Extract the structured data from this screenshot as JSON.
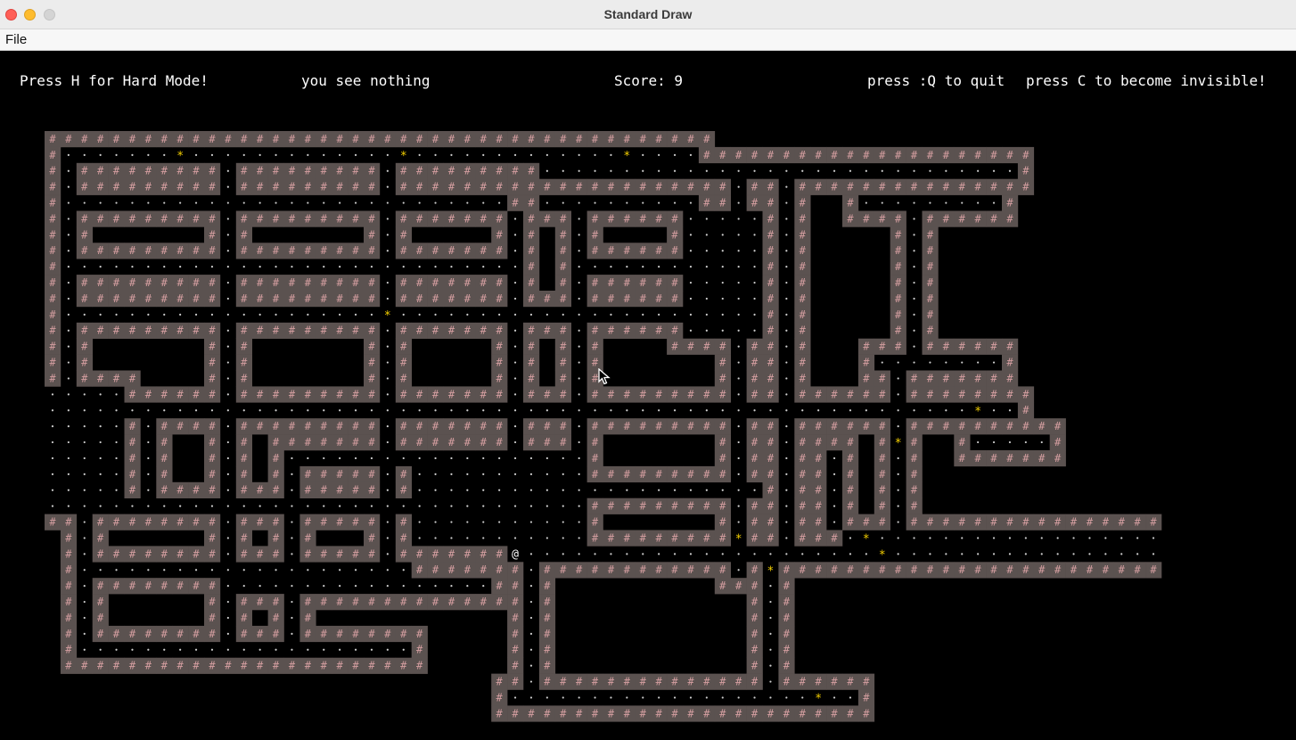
{
  "window": {
    "title": "Standard Draw"
  },
  "menu": {
    "file": "File"
  },
  "hud": {
    "hard_mode": "Press H for Hard Mode!",
    "tile_info": "you see nothing",
    "score": "Score: 9",
    "quit": "press :Q to quit",
    "invisible": "press C to become invisible!"
  },
  "tiles": {
    "wall": "#",
    "floor": "·",
    "coin": "*",
    "player": "@"
  },
  "colors": {
    "wall_bg": "#5b5250",
    "wall_fg": "#d49ea0",
    "floor": "#cfcfcf",
    "coin": "#f5d000",
    "player": "#ffffff",
    "background": "#000000",
    "hud_text": "#ffffff"
  }
}
